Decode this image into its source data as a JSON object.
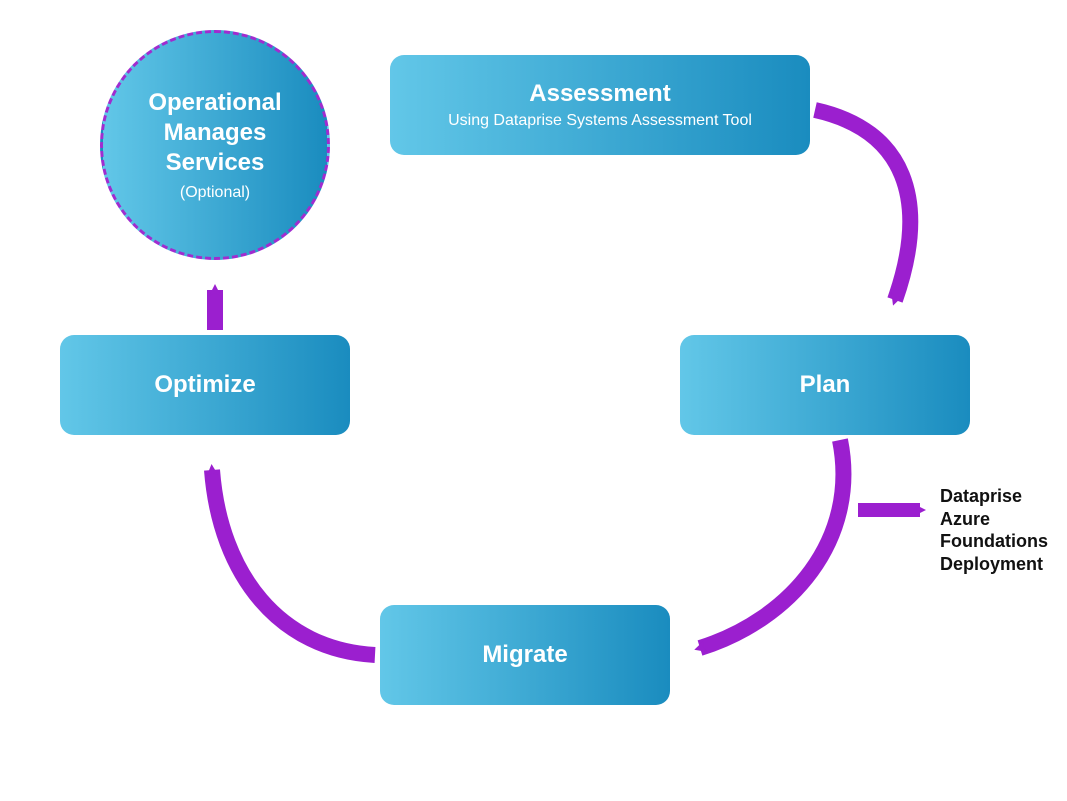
{
  "colors": {
    "arrow": "#9b1fcf",
    "box_gradient_start": "#62c7e8",
    "box_gradient_end": "#1a8cbf",
    "circle_border": "#a02ccf"
  },
  "nodes": {
    "assessment": {
      "title": "Assessment",
      "subtitle": "Using Dataprise Systems Assessment Tool"
    },
    "plan": {
      "title": "Plan"
    },
    "migrate": {
      "title": "Migrate"
    },
    "optimize": {
      "title": "Optimize"
    },
    "operational": {
      "title": "Operational Manages Services",
      "subtitle": "(Optional)"
    }
  },
  "side_label": {
    "lines": [
      "Dataprise",
      "Azure",
      "Foundations",
      "Deployment"
    ]
  },
  "flow_order": [
    "assessment",
    "plan",
    "migrate",
    "optimize",
    "operational"
  ],
  "branch": {
    "from": "plan",
    "to_label": "side_label"
  }
}
